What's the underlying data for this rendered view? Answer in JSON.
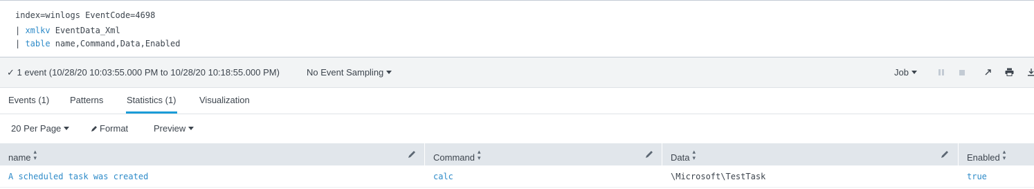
{
  "search": {
    "line1": "index=winlogs EventCode=4698",
    "line2_pipe": "| ",
    "line2_cmd": "xmlkv",
    "line2_args": " EventData_Xml",
    "line3_pipe": "| ",
    "line3_cmd": "table",
    "line3_args": " name,Command,Data,Enabled"
  },
  "job_status": {
    "event_count": "✓ 1 event (10/28/20 10:03:55.000 PM to 10/28/20 10:18:55.000 PM)",
    "sampling": "No Event Sampling",
    "job_label": "Job"
  },
  "tabs": [
    {
      "label": "Events (1)"
    },
    {
      "label": "Patterns"
    },
    {
      "label": "Statistics (1)"
    },
    {
      "label": "Visualization"
    }
  ],
  "table_controls": {
    "per_page": "20 Per Page",
    "format": "Format",
    "preview": "Preview"
  },
  "table": {
    "columns": [
      "name",
      "Command",
      "Data",
      "Enabled"
    ],
    "rows": [
      [
        "A scheduled task was created",
        "calc",
        "\\Microsoft\\TestTask",
        "true"
      ]
    ]
  },
  "colors": {
    "accent": "#1a9cd8",
    "link": "#2e8bc9",
    "header_bg": "#e1e6eb",
    "job_bar_bg": "#f2f4f5"
  }
}
